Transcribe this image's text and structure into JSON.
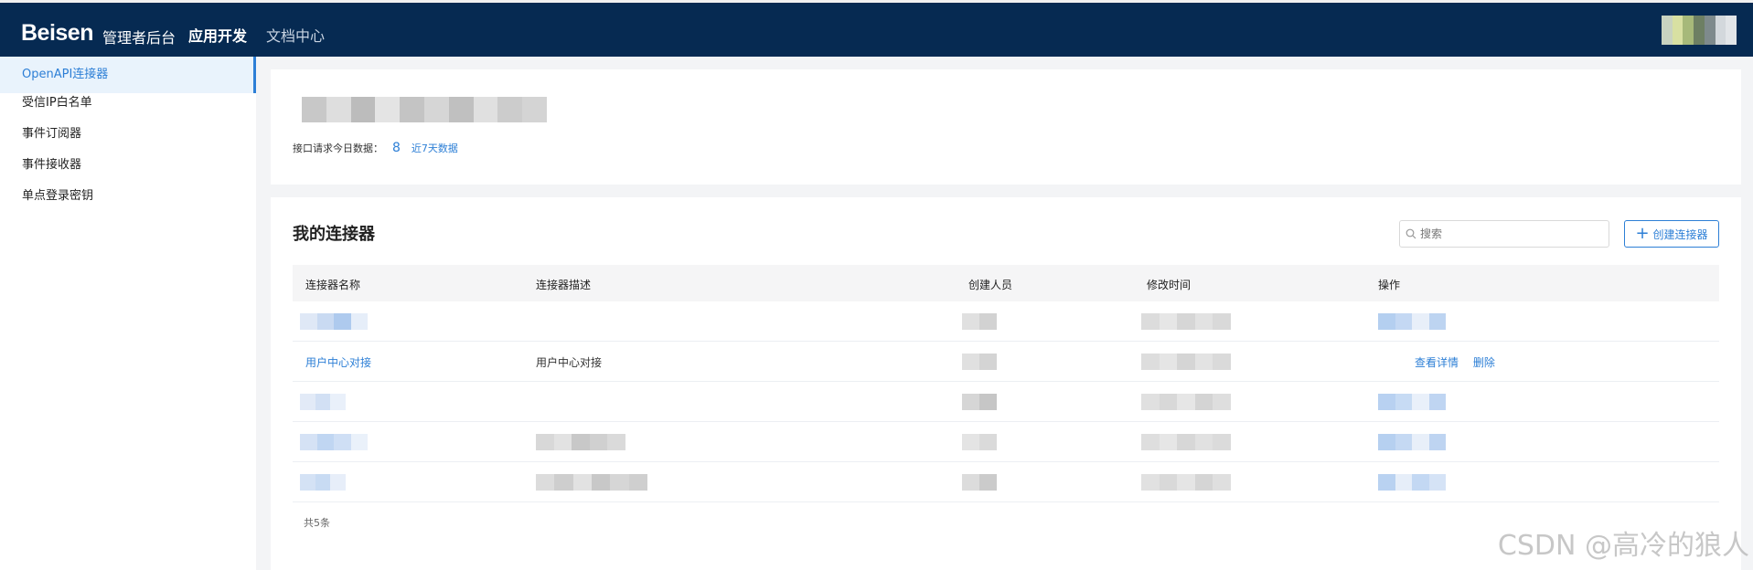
{
  "header": {
    "logo": "Beisen",
    "subtitle": "管理者后台",
    "nav": [
      {
        "label": "应用开发",
        "active": true
      },
      {
        "label": "文档中心",
        "active": false
      }
    ]
  },
  "sidebar": {
    "items": [
      {
        "label": "OpenAPI连接器",
        "active": true
      },
      {
        "label": "受信IP白名单",
        "active": false
      },
      {
        "label": "事件订阅器",
        "active": false
      },
      {
        "label": "事件接收器",
        "active": false
      },
      {
        "label": "单点登录密钥",
        "active": false
      }
    ]
  },
  "stats": {
    "label": "接口请求今日数据：",
    "count": "8",
    "link": "近7天数据"
  },
  "connectors": {
    "title": "我的连接器",
    "search_placeholder": "搜索",
    "create_label": "创建连接器",
    "columns": [
      "连接器名称",
      "连接器描述",
      "创建人员",
      "修改时间",
      "操作"
    ],
    "rows": [
      {
        "name": "",
        "desc": "",
        "creator": "",
        "modified": ""
      },
      {
        "name": "用户中心对接",
        "desc": "用户中心对接",
        "creator": "",
        "modified": ""
      },
      {
        "name": "",
        "desc": "",
        "creator": "",
        "modified": ""
      },
      {
        "name": "",
        "desc": "",
        "creator": "",
        "modified": ""
      },
      {
        "name": "",
        "desc": "",
        "creator": "",
        "modified": ""
      }
    ],
    "actions": {
      "view": "查看详情",
      "delete": "删除"
    },
    "total": "共5条"
  },
  "watermark": "CSDN @高冷的狼人",
  "colors": {
    "topbar": "#062a52",
    "accent": "#2d7fd6",
    "sidebar_active_bg": "#e9f3fc"
  }
}
